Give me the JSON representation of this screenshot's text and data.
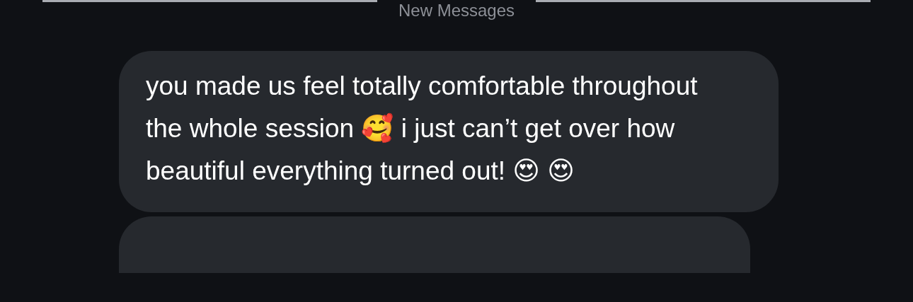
{
  "divider": {
    "label": "New Messages"
  },
  "messages": [
    {
      "kind": "text",
      "text": "you made us feel totally comfortable throughout the whole session 🥰 i just can’t get over how beautiful everything turned out! 😍 😍"
    },
    {
      "kind": "cut"
    }
  ]
}
